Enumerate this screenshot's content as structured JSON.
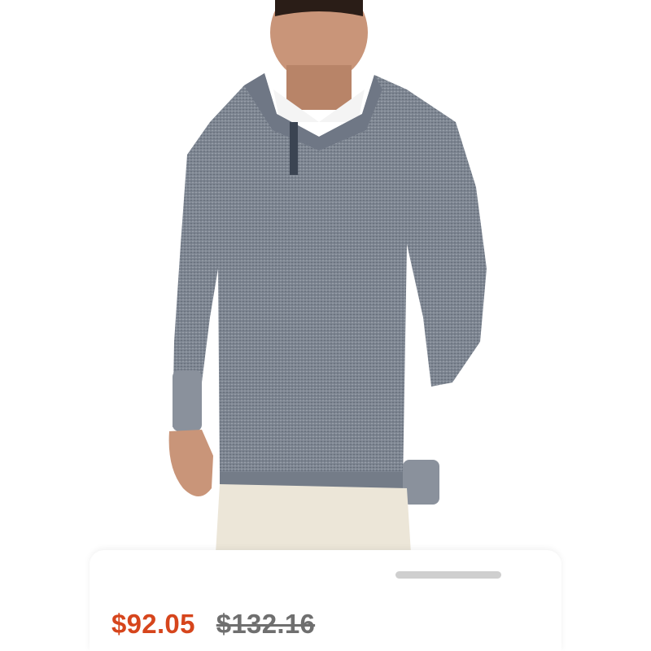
{
  "product": {
    "image_description_icon": "sweater-photo",
    "price": {
      "sale": "$92.05",
      "original": "$132.16"
    }
  },
  "colors": {
    "sale_price": "#d6451c",
    "original_price": "#6f6f6f",
    "sweater": "#7d8591",
    "pants": "#ece6d8",
    "skin": "#c99579"
  }
}
